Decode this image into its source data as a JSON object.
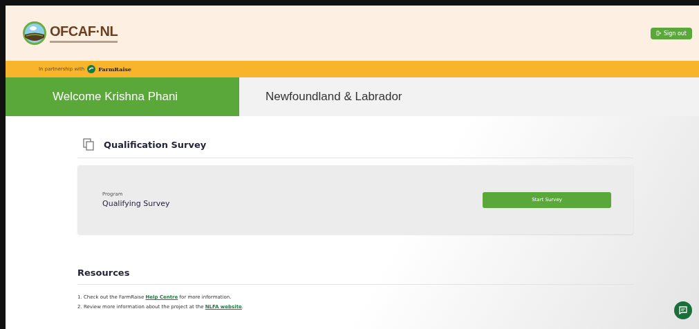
{
  "header": {
    "logo_text": "OFCAF·NL",
    "sign_out": "Sign out"
  },
  "partner_bar": {
    "text": "In partnership with",
    "partner": "FarmRaise"
  },
  "tabs": [
    {
      "label": "Welcome Krishna Phani",
      "selected": true
    },
    {
      "label": "Newfoundland & Labrador",
      "selected": false
    }
  ],
  "survey": {
    "title": "Qualification Survey",
    "program_label": "Program",
    "program_name": "Qualifying Survey",
    "button": "Start Survey"
  },
  "resources": {
    "title": "Resources",
    "items": [
      {
        "before": "1. Check out the FarmRaise ",
        "link": "Help Centre",
        "after": " for more information."
      },
      {
        "before": "2. Review more information about the project at the ",
        "link": "NLFA website",
        "after": "."
      }
    ]
  }
}
